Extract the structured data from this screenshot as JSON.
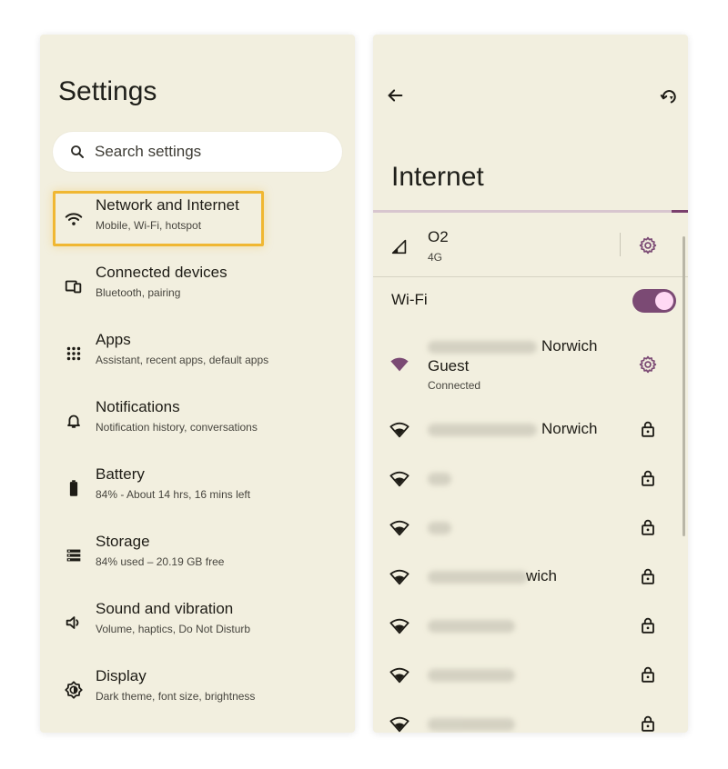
{
  "settings": {
    "title": "Settings",
    "search_placeholder": "Search settings",
    "items": [
      {
        "icon": "wifi-icon",
        "title": "Network and Internet",
        "subtitle": "Mobile, Wi-Fi, hotspot",
        "highlighted": true
      },
      {
        "icon": "connected-devices-icon",
        "title": "Connected devices",
        "subtitle": "Bluetooth, pairing"
      },
      {
        "icon": "apps-grid-icon",
        "title": "Apps",
        "subtitle": "Assistant, recent apps, default apps"
      },
      {
        "icon": "bell-icon",
        "title": "Notifications",
        "subtitle": "Notification history, conversations"
      },
      {
        "icon": "battery-icon",
        "title": "Battery",
        "subtitle": "84% - About 14 hrs, 16 mins left"
      },
      {
        "icon": "storage-icon",
        "title": "Storage",
        "subtitle": "84% used – 20.19 GB free"
      },
      {
        "icon": "speaker-icon",
        "title": "Sound and vibration",
        "subtitle": "Volume, haptics, Do Not Disturb"
      },
      {
        "icon": "display-brightness-icon",
        "title": "Display",
        "subtitle": "Dark theme, font size, brightness"
      }
    ],
    "highlight_color": "#f0b732"
  },
  "internet": {
    "title": "Internet",
    "mobile": {
      "name": "O2",
      "type": "4G"
    },
    "wifi_label": "Wi-Fi",
    "wifi_enabled": true,
    "connected_network": {
      "name_suffix": "Norwich",
      "name_line2": "Guest",
      "status": "Connected"
    },
    "networks": [
      {
        "visible_text": "Norwich"
      },
      {
        "visible_text": ""
      },
      {
        "visible_text": ""
      },
      {
        "visible_text": "wich"
      },
      {
        "visible_text": ""
      },
      {
        "visible_text": ""
      },
      {
        "visible_text": ""
      }
    ],
    "accent_color": "#7b4a74"
  }
}
